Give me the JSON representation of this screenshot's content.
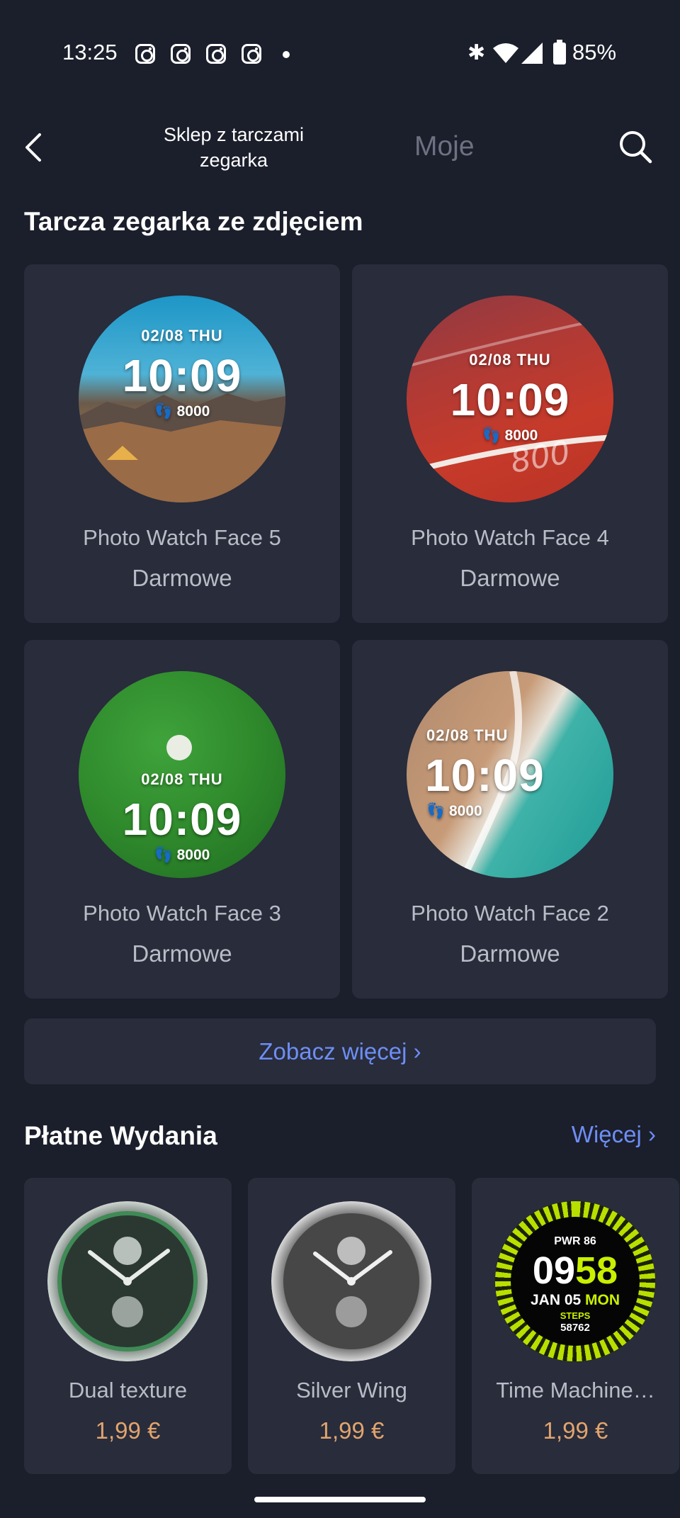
{
  "status_bar": {
    "time": "13:25",
    "battery": "85%",
    "icons": [
      "instagram-icon",
      "instagram-icon",
      "instagram-icon",
      "instagram-icon",
      "bluetooth-icon",
      "wifi-icon",
      "signal-icon",
      "battery-icon"
    ]
  },
  "header": {
    "tab_store": "Sklep z tarczami zegarka",
    "tab_mine": "Moje",
    "icons": [
      "back-icon",
      "search-icon"
    ]
  },
  "photo_section": {
    "title": "Tarcza zegarka ze zdjęciem",
    "cards": [
      {
        "name": "Photo Watch Face 5",
        "price": "Darmowe",
        "date": "02/08  THU",
        "time": "10:09",
        "steps": "8000",
        "scene": "mountain"
      },
      {
        "name": "Photo Watch Face 4",
        "price": "Darmowe",
        "date": "02/08  THU",
        "time": "10:09",
        "steps": "8000",
        "scene": "track"
      },
      {
        "name": "Photo Watch Face 3",
        "price": "Darmowe",
        "date": "02/08  THU",
        "time": "10:09",
        "steps": "8000",
        "scene": "grass"
      },
      {
        "name": "Photo Watch Face 2",
        "price": "Darmowe",
        "date": "02/08  THU",
        "time": "10:09",
        "steps": "8000",
        "scene": "beach"
      }
    ],
    "see_more": "Zobacz więcej"
  },
  "paid_section": {
    "title": "Płatne Wydania",
    "more": "Więcej",
    "cards": [
      {
        "name": "Dual texture",
        "price": "1,99 €"
      },
      {
        "name": "Silver Wing",
        "price": "1,99 €"
      },
      {
        "name": "Time Machine…",
        "price": "1,99 €",
        "face": {
          "pwr": "PWR 86",
          "hour": "09",
          "minute": "58",
          "date": "JAN 05",
          "day": "MON",
          "steps_label": "STEPS",
          "steps": "58762"
        }
      }
    ]
  },
  "colors": {
    "background": "#1b1e2b",
    "card": "#282c3b",
    "accent": "#6e8ef5",
    "price": "#e2a46e",
    "muted_text": "#b9bcc6"
  }
}
